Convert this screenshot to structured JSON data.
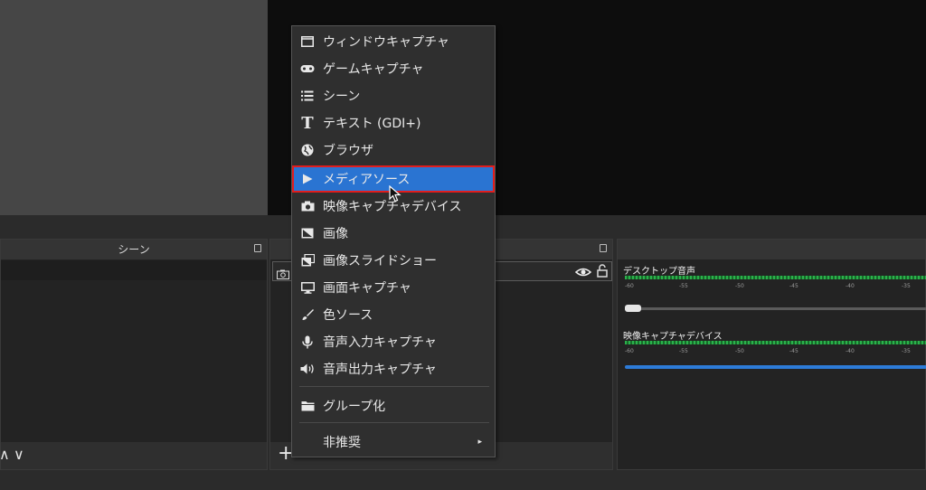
{
  "docks": {
    "scenes": {
      "title": "シーン"
    },
    "mixer": {
      "channels": [
        {
          "name": "デスクトップ音声",
          "ticks": [
            "-60",
            "-55",
            "-50",
            "-45",
            "-40",
            "-35"
          ]
        },
        {
          "name": "映像キャプチャデバイス",
          "ticks": [
            "-60",
            "-55",
            "-50",
            "-45",
            "-40",
            "-35"
          ]
        }
      ]
    }
  },
  "context_menu": {
    "items": [
      {
        "label": "ウィンドウキャプチャ",
        "icon": "window-icon"
      },
      {
        "label": "ゲームキャプチャ",
        "icon": "gamepad-icon"
      },
      {
        "label": "シーン",
        "icon": "list-icon"
      },
      {
        "label": "テキスト (GDI+)",
        "icon": "text-icon"
      },
      {
        "label": "ブラウザ",
        "icon": "globe-icon"
      },
      {
        "label": "メディアソース",
        "icon": "play-icon",
        "selected": true
      },
      {
        "label": "映像キャプチャデバイス",
        "icon": "camera-icon"
      },
      {
        "label": "画像",
        "icon": "image-icon"
      },
      {
        "label": "画像スライドショー",
        "icon": "slideshow-icon"
      },
      {
        "label": "画面キャプチャ",
        "icon": "monitor-icon"
      },
      {
        "label": "色ソース",
        "icon": "brush-icon"
      },
      {
        "label": "音声入力キャプチャ",
        "icon": "microphone-icon"
      },
      {
        "label": "音声出力キャプチャ",
        "icon": "speaker-icon"
      },
      {
        "label": "グループ化",
        "icon": "folder-icon"
      },
      {
        "label": "非推奨",
        "icon": "",
        "submenu": true
      }
    ],
    "submenu_arrow": "▸"
  },
  "icons": {
    "add": "+",
    "chevron_up": "∧",
    "chevron_down": "∨",
    "eye": "👁",
    "lock": "🔓"
  },
  "colors": {
    "selected_bg": "#2a74d2",
    "selected_outline": "#e11d1d",
    "meter_green": "#2bb24c",
    "slider_blue": "#2d7bd8"
  }
}
